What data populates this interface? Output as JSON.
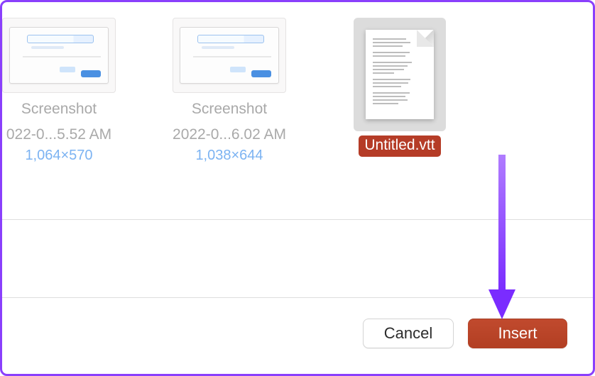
{
  "files": [
    {
      "name_line1": "Screenshot",
      "name_line2": "022-0...5.52 AM",
      "dimensions": "1,064×570",
      "selected": false,
      "kind": "image"
    },
    {
      "name_line1": "Screenshot",
      "name_line2": "2022-0...6.02 AM",
      "dimensions": "1,038×644",
      "selected": false,
      "kind": "image"
    },
    {
      "name_line1": "Untitled.vtt",
      "selected": true,
      "kind": "document"
    }
  ],
  "buttons": {
    "cancel": "Cancel",
    "insert": "Insert"
  },
  "colors": {
    "accent_selection": "#b53c27",
    "primary_button": "#b84a2f",
    "frame_border": "#8a3ffc",
    "annotation_arrow": "#8a3ffc"
  }
}
